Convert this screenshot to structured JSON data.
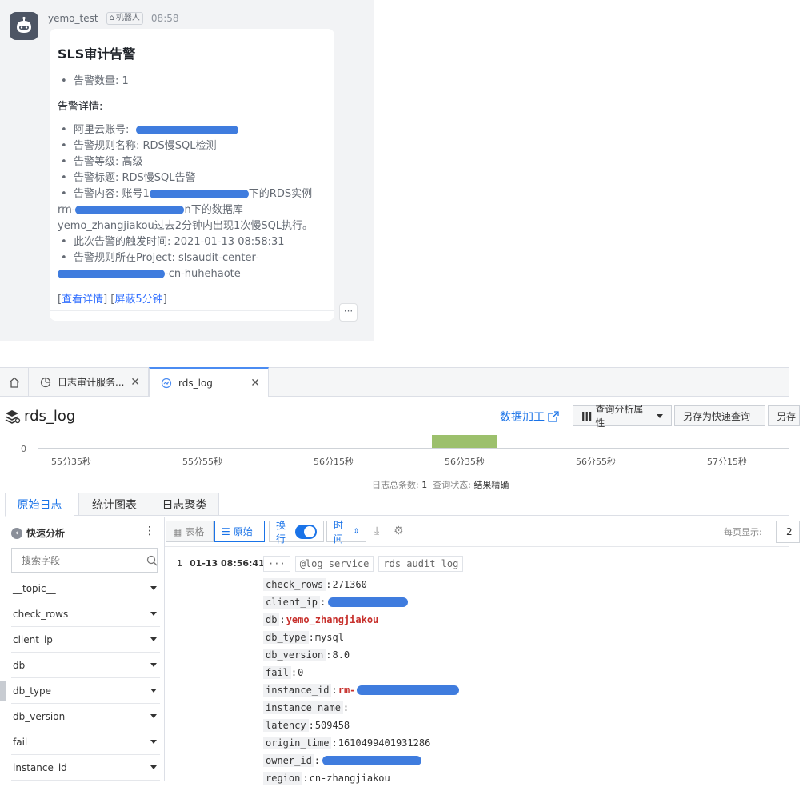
{
  "chat": {
    "sender_name": "yemo_test",
    "robot_tag": "机器人",
    "time": "08:58",
    "card_title": "SLS审计告警",
    "summary": "告警数量: 1",
    "details_heading": "告警详情:",
    "account_label": "阿里云账号:",
    "rule_name": "告警规则名称: RDS慢SQL检测",
    "level": "告警等级: 高级",
    "alert_title": "告警标题: RDS慢SQL告警",
    "content_prefix": "告警内容: 账号1",
    "content_mid": "下的RDS实例",
    "instance_prefix": "rm-",
    "instance_suffix": "n下的数据库",
    "content_rest": "yemo_zhangjiakou过去2分钟内出现1次慢SQL执行。",
    "trigger_time": "此次告警的触发时间: 2021-01-13 08:58:31",
    "project_label": "告警规则所在Project: slsaudit-center-",
    "project_suffix": "-cn-huhehaote",
    "action_detail": "查看详情",
    "action_mute": "屏蔽5分钟",
    "more": "···"
  },
  "console": {
    "tabs": [
      {
        "label": "日志审计服务..."
      },
      {
        "label": "rds_log"
      }
    ],
    "logstore_title": "rds_log",
    "data_process": "数据加工",
    "btn_query_attr": "查询分析属性",
    "btn_save_quick": "另存为快速查询",
    "btn_save_as": "另存",
    "histogram": {
      "zero": "0",
      "ticks": [
        "55分35秒",
        "55分55秒",
        "56分15秒",
        "56分35秒",
        "56分55秒",
        "57分15秒"
      ]
    },
    "status": {
      "total_label": "日志总条数:",
      "total_value": "1",
      "state_label": "查询状态:",
      "state_value": "结果精确"
    },
    "view_tabs": [
      "原始日志",
      "统计图表",
      "日志聚类"
    ],
    "sidebar": {
      "title": "快速分析",
      "search_placeholder": "搜索字段",
      "fields": [
        "__topic__",
        "check_rows",
        "client_ip",
        "db",
        "db_type",
        "db_version",
        "fail",
        "instance_id"
      ]
    },
    "toolbar": {
      "table": "表格",
      "raw": "原始",
      "wrap": "换行",
      "time": "时间",
      "per_page_label": "每页显示:",
      "per_page_value": "2"
    },
    "log": {
      "index": "1",
      "time": "01-13 08:56:41",
      "more": "···",
      "tags": [
        "@log_service",
        "rds_audit_log"
      ],
      "entries": [
        {
          "k": "check_rows",
          "v": "271360"
        },
        {
          "k": "client_ip",
          "v": ""
        },
        {
          "k": "db",
          "v": "yemo_zhangjiakou"
        },
        {
          "k": "db_type",
          "v": "mysql"
        },
        {
          "k": "db_version",
          "v": "8.0"
        },
        {
          "k": "fail",
          "v": "0"
        },
        {
          "k": "instance_id",
          "v": "rm-"
        },
        {
          "k": "instance_name",
          "v": ""
        },
        {
          "k": "latency",
          "v": "509458"
        },
        {
          "k": "origin_time",
          "v": "1610499401931286"
        },
        {
          "k": "owner_id",
          "v": ""
        },
        {
          "k": "region",
          "v": "cn-zhangjiakou"
        }
      ]
    }
  }
}
